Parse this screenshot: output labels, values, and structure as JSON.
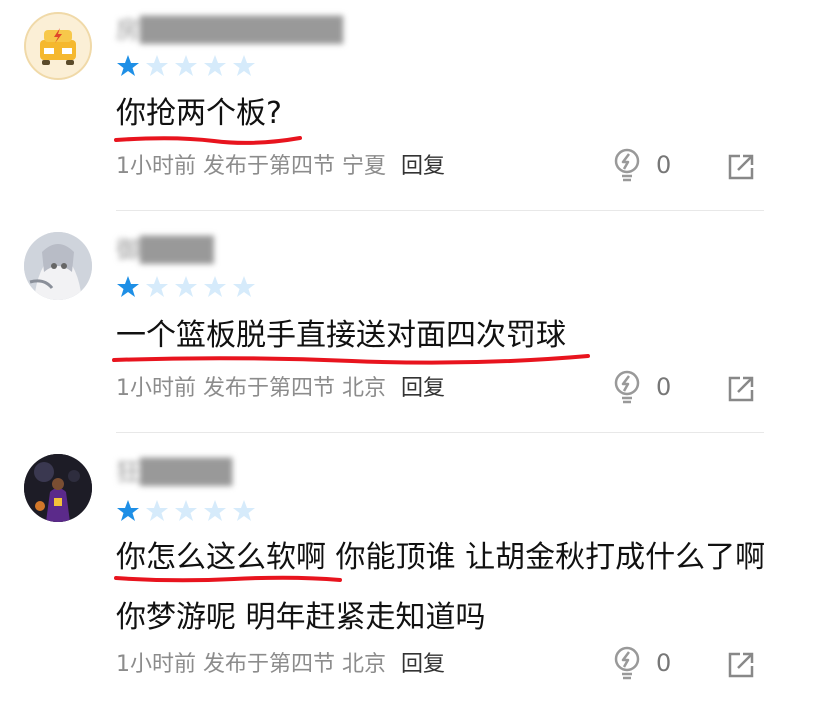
{
  "colors": {
    "star_active": "#1E8FE6",
    "star_inactive": "#D6EBFB",
    "underline": "#E8141E"
  },
  "comments": [
    {
      "username": "房███████████",
      "rating": 1,
      "text": "你抢两个板?",
      "time": "1小时前",
      "published_in": "发布于第四节",
      "location": "宁夏",
      "reply_label": "回复",
      "likes": "0",
      "avatar_icon": "lightning-car-avatar-icon"
    },
    {
      "username": "御████",
      "rating": 1,
      "text": "一个篮板脱手直接送对面四次罚球",
      "time": "1小时前",
      "published_in": "发布于第四节",
      "location": "北京",
      "reply_label": "回复",
      "likes": "0",
      "avatar_icon": "anime-character-avatar-icon"
    },
    {
      "username": "狂█████",
      "rating": 1,
      "text": "你怎么这么软啊 你能顶谁 让胡金秋打成什么了啊 你梦游呢 明年赶紧走知道吗",
      "time": "1小时前",
      "published_in": "发布于第四节",
      "location": "北京",
      "reply_label": "回复",
      "likes": "0",
      "avatar_icon": "basketball-player-avatar-icon"
    }
  ]
}
